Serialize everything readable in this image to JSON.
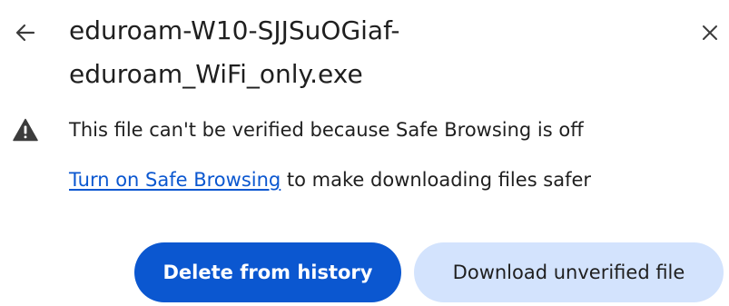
{
  "dialog": {
    "filename_line1": "eduroam-W10-SJJSuOGiaf-",
    "filename_line2": "eduroam_WiFi_only.exe",
    "warning_text": "This file can't be verified because Safe Browsing is off",
    "hint_link": "Turn on Safe Browsing",
    "hint_rest": " to make downloading files safer",
    "delete_label": "Delete from history",
    "download_label": "Download unverified file"
  },
  "icons": {
    "back": "arrow-left-icon",
    "close": "close-icon",
    "warning": "warning-triangle-icon"
  },
  "colors": {
    "primary": "#0b57d0",
    "secondary_bg": "#d3e3fd",
    "text": "#1f1f1f",
    "link": "#0b57d0"
  }
}
